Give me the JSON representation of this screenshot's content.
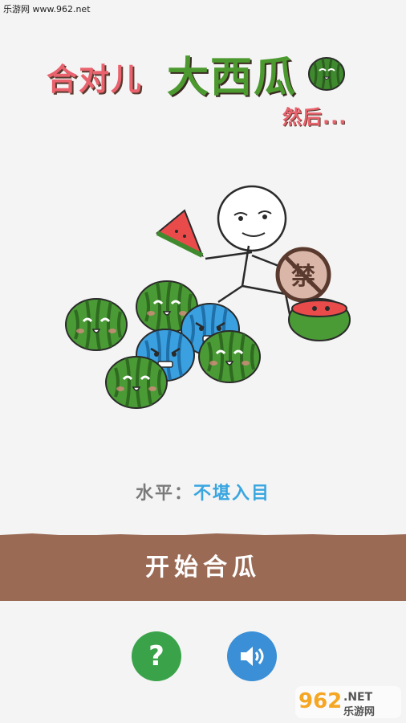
{
  "watermark_top": "乐游网 www.962.net",
  "title": {
    "part1": "合对儿",
    "part2": "大西瓜",
    "part3": "然后..."
  },
  "forbidden_sign": "禁",
  "level": {
    "label": "水平：",
    "value": "不堪入目"
  },
  "start_button": "开始合瓜",
  "help_button": "?",
  "logo": {
    "number": "962",
    "tld": ".NET",
    "cn": "乐游网"
  },
  "colors": {
    "background": "#f4f4f4",
    "title_red": "#e9626d",
    "title_green": "#4c9a2f",
    "start_bar": "#9a6a55",
    "help_green": "#3aa34a",
    "sound_blue": "#3a8fd6",
    "level_value_blue": "#3aa6e0"
  }
}
